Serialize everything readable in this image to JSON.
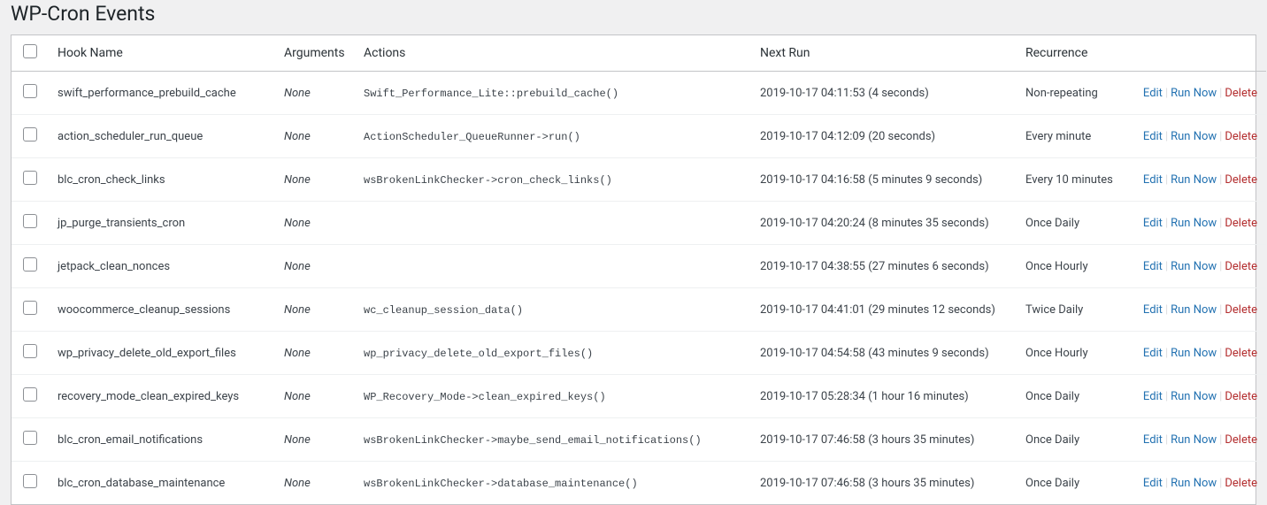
{
  "title": "WP-Cron Events",
  "columns": {
    "hook": "Hook Name",
    "arguments": "Arguments",
    "actions": "Actions",
    "next_run": "Next Run",
    "recurrence": "Recurrence"
  },
  "row_actions": {
    "edit": "Edit",
    "run_now": "Run Now",
    "delete": "Delete"
  },
  "rows": [
    {
      "hook": "swift_performance_prebuild_cache",
      "arguments": "None",
      "actions": "Swift_Performance_Lite::prebuild_cache()",
      "next_run": "2019-10-17 04:11:53 (4 seconds)",
      "recurrence": "Non-repeating"
    },
    {
      "hook": "action_scheduler_run_queue",
      "arguments": "None",
      "actions": "ActionScheduler_QueueRunner->run()",
      "next_run": "2019-10-17 04:12:09 (20 seconds)",
      "recurrence": "Every minute"
    },
    {
      "hook": "blc_cron_check_links",
      "arguments": "None",
      "actions": "wsBrokenLinkChecker->cron_check_links()",
      "next_run": "2019-10-17 04:16:58 (5 minutes 9 seconds)",
      "recurrence": "Every 10 minutes"
    },
    {
      "hook": "jp_purge_transients_cron",
      "arguments": "None",
      "actions": "",
      "next_run": "2019-10-17 04:20:24 (8 minutes 35 seconds)",
      "recurrence": "Once Daily"
    },
    {
      "hook": "jetpack_clean_nonces",
      "arguments": "None",
      "actions": "",
      "next_run": "2019-10-17 04:38:55 (27 minutes 6 seconds)",
      "recurrence": "Once Hourly"
    },
    {
      "hook": "woocommerce_cleanup_sessions",
      "arguments": "None",
      "actions": "wc_cleanup_session_data()",
      "next_run": "2019-10-17 04:41:01 (29 minutes 12 seconds)",
      "recurrence": "Twice Daily"
    },
    {
      "hook": "wp_privacy_delete_old_export_files",
      "arguments": "None",
      "actions": "wp_privacy_delete_old_export_files()",
      "next_run": "2019-10-17 04:54:58 (43 minutes 9 seconds)",
      "recurrence": "Once Hourly"
    },
    {
      "hook": "recovery_mode_clean_expired_keys",
      "arguments": "None",
      "actions": "WP_Recovery_Mode->clean_expired_keys()",
      "next_run": "2019-10-17 05:28:34 (1 hour 16 minutes)",
      "recurrence": "Once Daily"
    },
    {
      "hook": "blc_cron_email_notifications",
      "arguments": "None",
      "actions": "wsBrokenLinkChecker->maybe_send_email_notifications()",
      "next_run": "2019-10-17 07:46:58 (3 hours 35 minutes)",
      "recurrence": "Once Daily"
    },
    {
      "hook": "blc_cron_database_maintenance",
      "arguments": "None",
      "actions": "wsBrokenLinkChecker->database_maintenance()",
      "next_run": "2019-10-17 07:46:58 (3 hours 35 minutes)",
      "recurrence": "Once Daily"
    }
  ]
}
